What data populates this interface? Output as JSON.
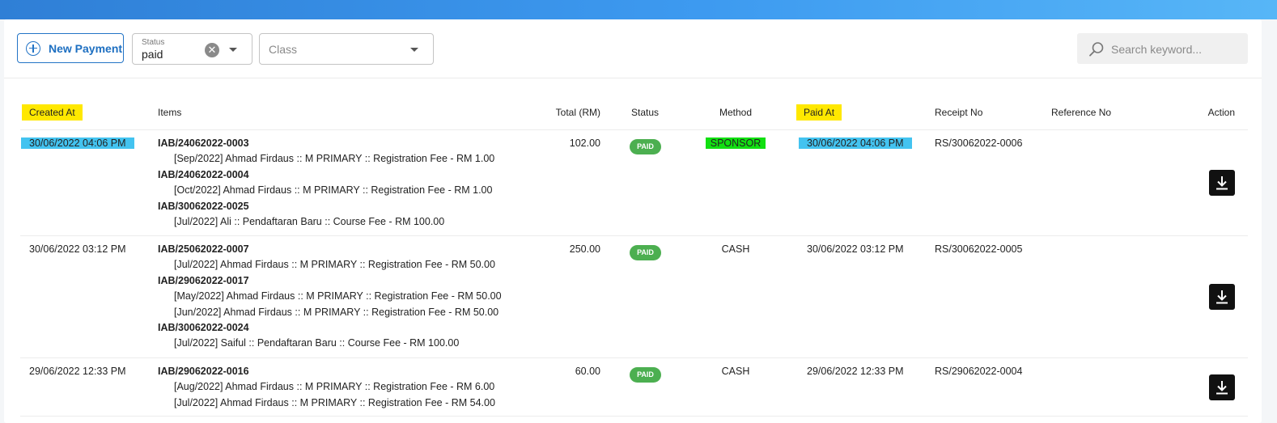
{
  "toolbar": {
    "new_payment_label": "New Payment",
    "status_filter": {
      "caption": "Status",
      "value": "paid"
    },
    "class_filter": {
      "placeholder": "Class"
    },
    "search": {
      "placeholder": "Search keyword..."
    }
  },
  "columns": {
    "created_at": "Created At",
    "items": "Items",
    "total": "Total (RM)",
    "status": "Status",
    "method": "Method",
    "paid_at": "Paid At",
    "receipt_no": "Receipt No",
    "reference_no": "Reference No",
    "action": "Action"
  },
  "rows": [
    {
      "created_at": "30/06/2022 04:06 PM",
      "items": [
        {
          "invoice": "IAB/24062022-0003",
          "lines": [
            "[Sep/2022] Ahmad Firdaus :: M PRIMARY :: Registration Fee - RM 1.00"
          ]
        },
        {
          "invoice": "IAB/24062022-0004",
          "lines": [
            "[Oct/2022] Ahmad Firdaus :: M PRIMARY :: Registration Fee - RM 1.00"
          ]
        },
        {
          "invoice": "IAB/30062022-0025",
          "lines": [
            "[Jul/2022] Ali :: Pendaftaran Baru :: Course Fee - RM 100.00"
          ]
        }
      ],
      "total": "102.00",
      "status": "PAID",
      "method": "SPONSOR",
      "paid_at": "30/06/2022 04:06 PM",
      "receipt_no": "RS/30062022-0006",
      "reference_no": ""
    },
    {
      "created_at": "30/06/2022 03:12 PM",
      "items": [
        {
          "invoice": "IAB/25062022-0007",
          "lines": [
            "[Jul/2022] Ahmad Firdaus :: M PRIMARY :: Registration Fee - RM 50.00"
          ]
        },
        {
          "invoice": "IAB/29062022-0017",
          "lines": [
            "[May/2022] Ahmad Firdaus :: M PRIMARY :: Registration Fee - RM 50.00",
            "[Jun/2022] Ahmad Firdaus :: M PRIMARY :: Registration Fee - RM 50.00"
          ]
        },
        {
          "invoice": "IAB/30062022-0024",
          "lines": [
            "[Jul/2022] Saiful :: Pendaftaran Baru :: Course Fee - RM 100.00"
          ]
        }
      ],
      "total": "250.00",
      "status": "PAID",
      "method": "CASH",
      "paid_at": "30/06/2022 03:12 PM",
      "receipt_no": "RS/30062022-0005",
      "reference_no": ""
    },
    {
      "created_at": "29/06/2022 12:33 PM",
      "items": [
        {
          "invoice": "IAB/29062022-0016",
          "lines": [
            "[Aug/2022] Ahmad Firdaus :: M PRIMARY :: Registration Fee - RM 6.00",
            "[Jul/2022] Ahmad Firdaus :: M PRIMARY :: Registration Fee - RM 54.00"
          ]
        }
      ],
      "total": "60.00",
      "status": "PAID",
      "method": "CASH",
      "paid_at": "29/06/2022 12:33 PM",
      "receipt_no": "RS/29062022-0004",
      "reference_no": ""
    }
  ],
  "icons": {
    "new_payment": "plus-circle-icon",
    "clear": "close-circle-icon",
    "dropdown": "chevron-down-icon",
    "search": "search-icon",
    "download": "download-icon"
  },
  "colors": {
    "primary": "#1d6fc1",
    "paid_badge": "#4caf50",
    "header_highlight": "#ffe800",
    "date_highlight": "#43c3f0",
    "sponsor_highlight": "#11e011"
  }
}
